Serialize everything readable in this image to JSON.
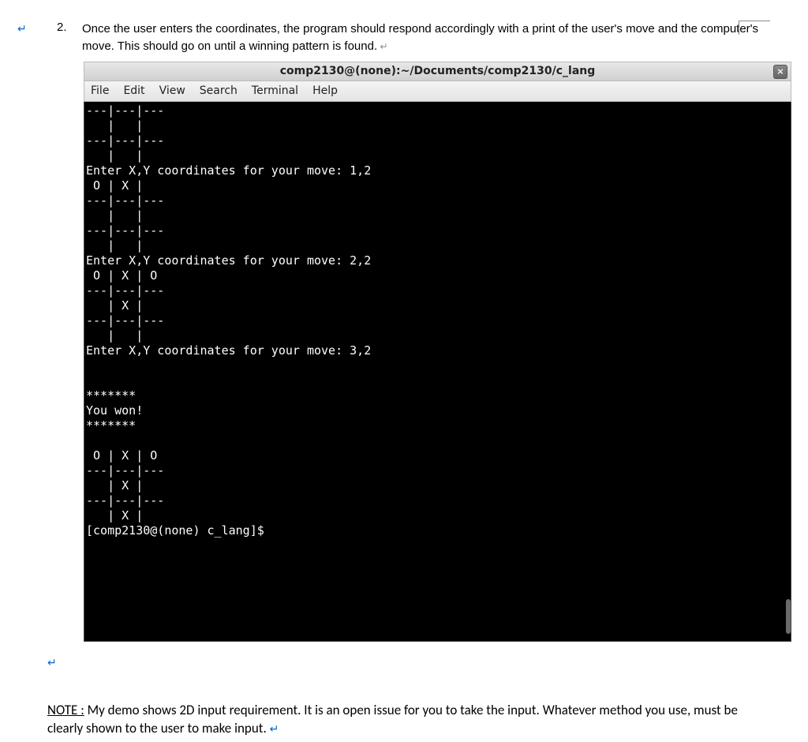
{
  "top_marker": "↵",
  "list": {
    "number": "2.",
    "text_a": "Once the user enters the coordinates, the program should respond accordingly with a print of the user's move and the computer's move. This should go on until a winning pattern is found.",
    "pilcrow": " ↵"
  },
  "terminal": {
    "title": "comp2130@(none):~/Documents/comp2130/c_lang",
    "close_glyph": "×",
    "menu": {
      "file": "File",
      "edit": "Edit",
      "view": "View",
      "search": "Search",
      "terminal": "Terminal",
      "help": "Help"
    },
    "body": "---|---|---\n   |   |\n---|---|---\n   |   |\nEnter X,Y coordinates for your move: 1,2\n O | X |\n---|---|---\n   |   |\n---|---|---\n   |   |\nEnter X,Y coordinates for your move: 2,2\n O | X | O\n---|---|---\n   | X |\n---|---|---\n   |   |\nEnter X,Y coordinates for your move: 3,2\n\n\n*******\nYou won!\n*******\n\n O | X | O\n---|---|---\n   | X |\n---|---|---\n   | X |\n[comp2130@(none) c_lang]$ "
  },
  "return_marker": "↵",
  "note": {
    "label": "NOTE :",
    "text": " My demo shows 2D input requirement. It is an open issue for you to take the input. Whatever method you use, must be clearly shown to the user to make input. ",
    "pilcrow": "↵"
  }
}
